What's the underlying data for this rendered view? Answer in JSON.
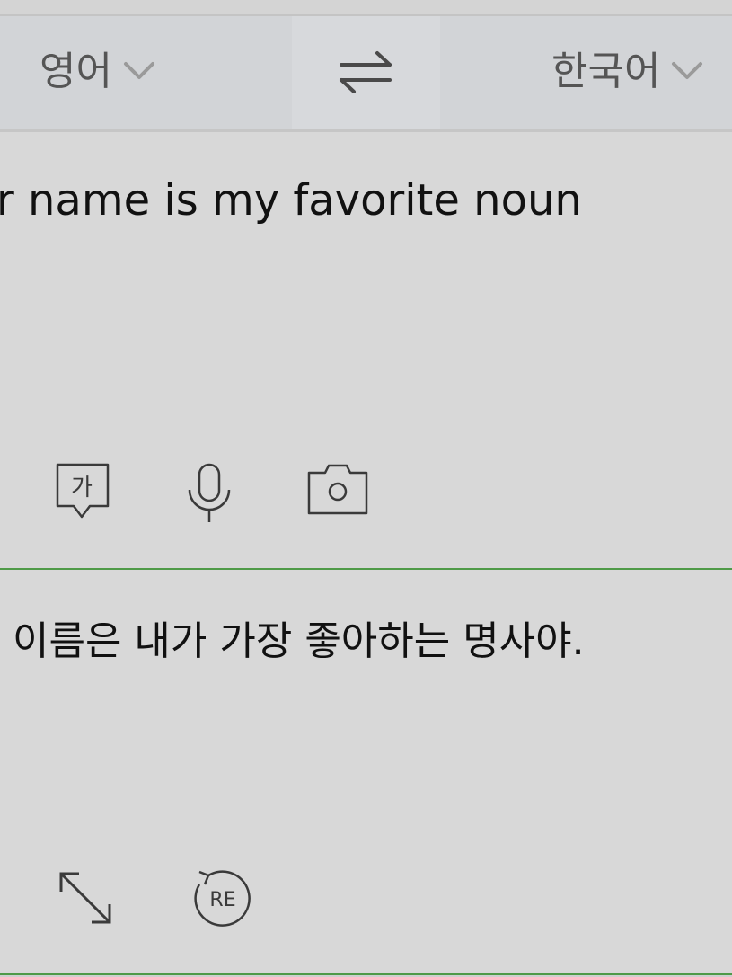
{
  "language_bar": {
    "source_language": "영어",
    "target_language": "한국어",
    "swap_icon": "swap-arrows-icon",
    "dropdown_icon": "chevron-down-icon"
  },
  "source_panel": {
    "text": "r name is my favorite noun",
    "tools": [
      {
        "icon": "handwriting-ga-icon",
        "glyph": "가"
      },
      {
        "icon": "microphone-icon"
      },
      {
        "icon": "camera-icon"
      }
    ]
  },
  "result_panel": {
    "text": "이름은 내가 가장 좋아하는 명사야.",
    "tools": [
      {
        "icon": "expand-arrow-icon"
      },
      {
        "icon": "retranslate-icon",
        "glyph": "RE"
      }
    ]
  },
  "colors": {
    "divider_accent": "#4f9a48",
    "background": "#d9d9d9",
    "icon": "#3a3a3a"
  }
}
